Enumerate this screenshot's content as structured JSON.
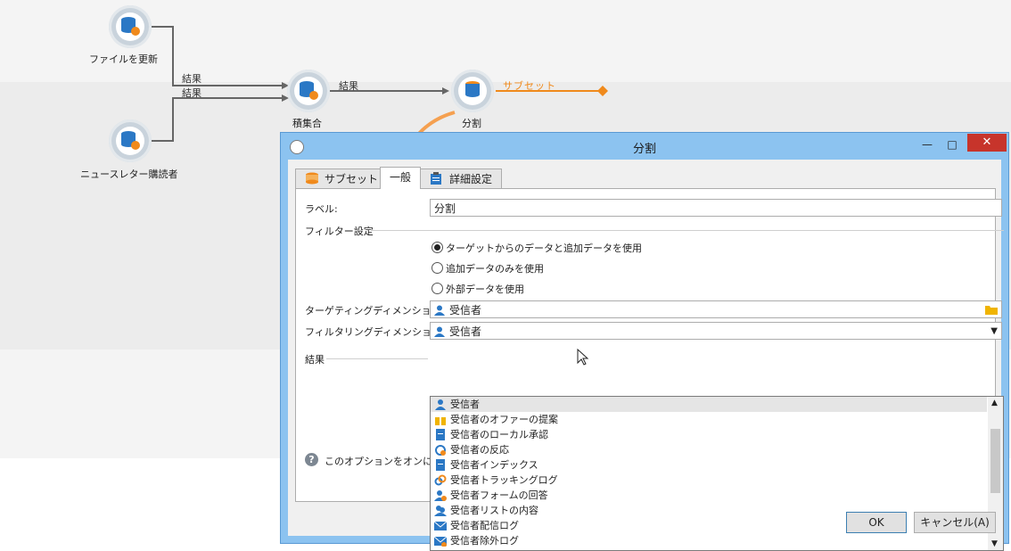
{
  "workflow": {
    "nodes": {
      "file_update": "ファイルを更新",
      "newsletter": "ニュースレター購読者",
      "intersection": "積集合",
      "split": "分割"
    },
    "connections": {
      "result_1": "結果",
      "result_2": "結果",
      "result_3": "結果",
      "subset": "サブセット"
    }
  },
  "dialog": {
    "title": "分割",
    "window_buttons": {
      "minimize": "—",
      "maximize": "□",
      "close": "✕"
    },
    "tabs": [
      "サブセット",
      "一般",
      "詳細設定"
    ],
    "label_caption": "ラベル:",
    "label_value": "分割",
    "filter_section": "フィルター設定",
    "radio_options": [
      "ターゲットからのデータと追加データを使用",
      "追加データのみを使用",
      "外部データを使用"
    ],
    "targeting_caption": "ターゲティングディメンション:",
    "targeting_value": "受信者",
    "filtering_caption": "フィルタリングディメンション:",
    "filtering_value": "受信者",
    "result_section": "結果",
    "help_text": "このオプションをオンにす",
    "dropdown_items": [
      "受信者",
      "受信者のオファーの提案",
      "受信者のローカル承認",
      "受信者の反応",
      "受信者インデックス",
      "受信者トラッキングログ",
      "受信者フォームの回答",
      "受信者リストの内容",
      "受信者配信ログ",
      "受信者除外ログ"
    ],
    "ok_label": "OK",
    "cancel_label": "キャンセル(A)"
  },
  "colors": {
    "accent": "#f08a1c",
    "node_icon": "#2b78c5",
    "close": "#c7342b"
  }
}
